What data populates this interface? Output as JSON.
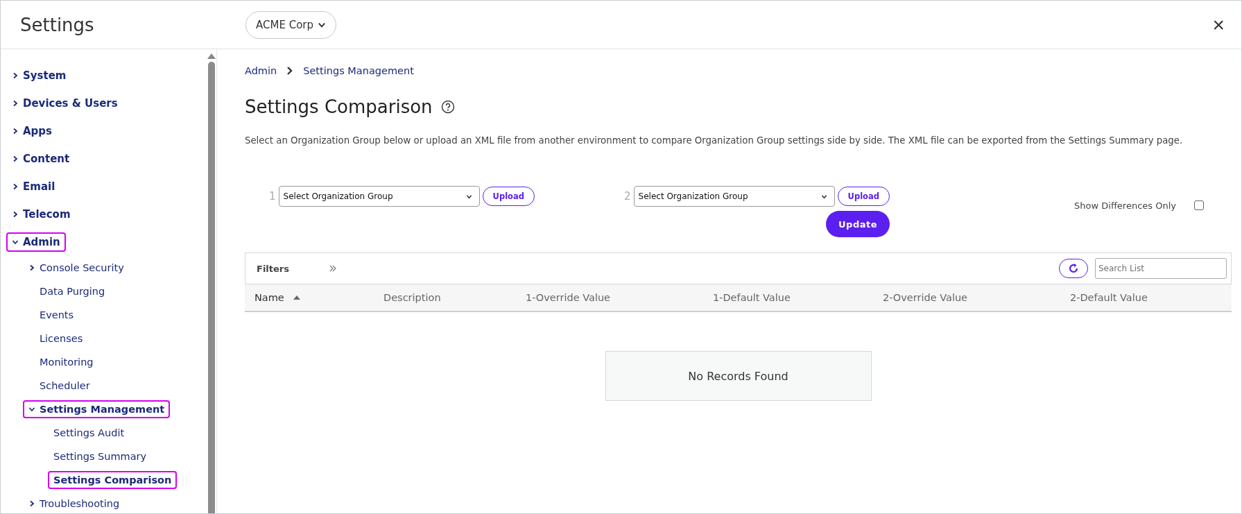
{
  "header": {
    "title": "Settings",
    "org_selector": "ACME Corp",
    "close": "×"
  },
  "sidebar": {
    "items": [
      {
        "label": "System",
        "expanded": false,
        "highlighted": false
      },
      {
        "label": "Devices & Users",
        "expanded": false,
        "highlighted": false
      },
      {
        "label": "Apps",
        "expanded": false,
        "highlighted": false
      },
      {
        "label": "Content",
        "expanded": false,
        "highlighted": false
      },
      {
        "label": "Email",
        "expanded": false,
        "highlighted": false
      },
      {
        "label": "Telecom",
        "expanded": false,
        "highlighted": false
      },
      {
        "label": "Admin",
        "expanded": true,
        "highlighted": true,
        "children": [
          {
            "label": "Console Security",
            "expanded": false,
            "highlighted": false
          },
          {
            "label": "Data Purging",
            "highlighted": false
          },
          {
            "label": "Events",
            "highlighted": false
          },
          {
            "label": "Licenses",
            "highlighted": false
          },
          {
            "label": "Monitoring",
            "highlighted": false
          },
          {
            "label": "Scheduler",
            "highlighted": false
          },
          {
            "label": "Settings Management",
            "expanded": true,
            "highlighted": true,
            "children": [
              {
                "label": "Settings Audit",
                "highlighted": false,
                "selected": false
              },
              {
                "label": "Settings Summary",
                "highlighted": false,
                "selected": false
              },
              {
                "label": "Settings Comparison",
                "highlighted": true,
                "selected": true
              }
            ]
          },
          {
            "label": "Troubleshooting",
            "expanded": false,
            "highlighted": false
          }
        ]
      }
    ]
  },
  "breadcrumb": [
    "Admin",
    "Settings Management"
  ],
  "page_title": "Settings Comparison",
  "description": "Select an Organization Group below or upload an XML file from another environment to compare Organization Group settings side by side. The XML file can be exported from the Settings Summary page.",
  "selectors": [
    {
      "number": "1",
      "value": "Select Organization Group",
      "upload": "Upload"
    },
    {
      "number": "2",
      "value": "Select Organization Group",
      "upload": "Upload"
    }
  ],
  "update_button": "Update",
  "show_differences": {
    "label": "Show Differences Only",
    "checked": false
  },
  "filters": {
    "label": "Filters",
    "search_placeholder": "Search List"
  },
  "table": {
    "columns": [
      {
        "label": "Name",
        "sorted": true,
        "descending": false
      },
      {
        "label": "Description"
      },
      {
        "label": "1-Override Value"
      },
      {
        "label": "1-Default Value"
      },
      {
        "label": "2-Override Value"
      },
      {
        "label": "2-Default Value"
      }
    ],
    "empty_message": "No Records Found"
  }
}
